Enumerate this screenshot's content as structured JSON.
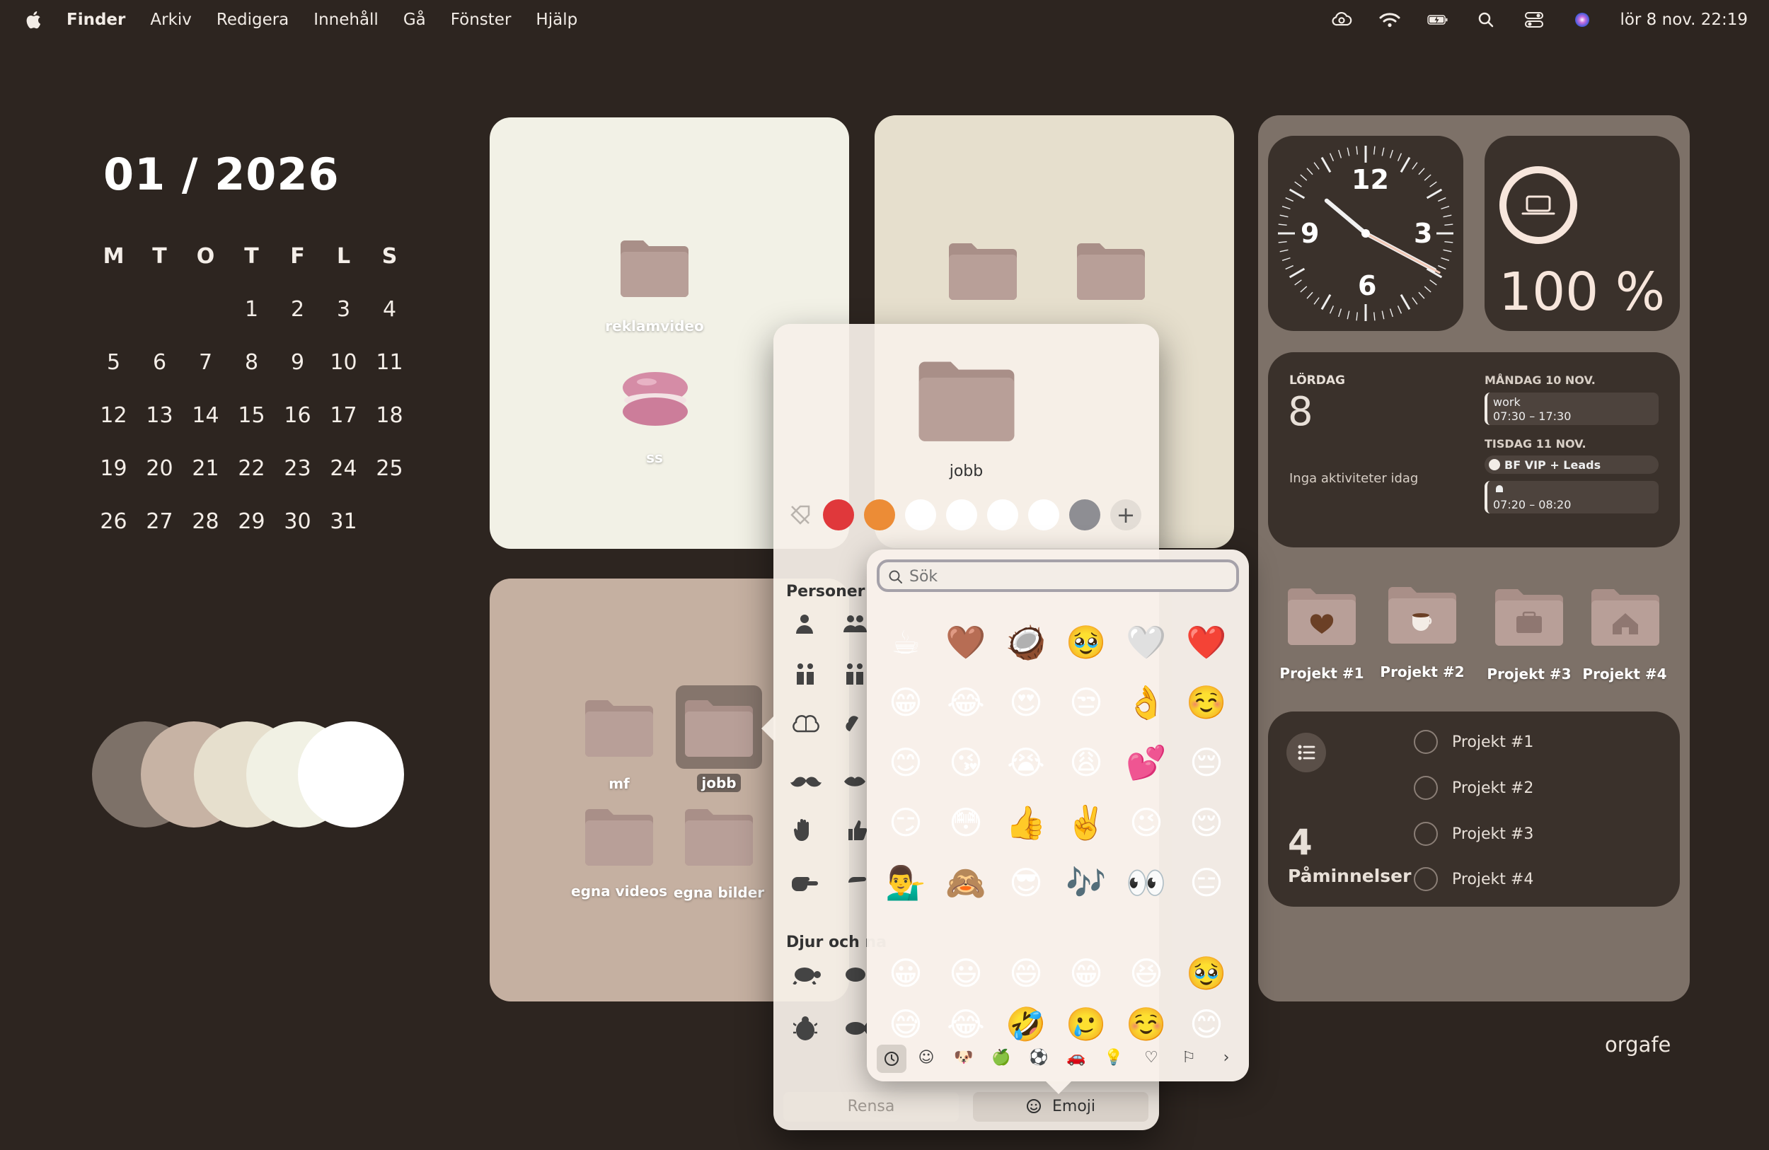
{
  "menubar": {
    "app": "Finder",
    "items": [
      "Arkiv",
      "Redigera",
      "Innehåll",
      "Gå",
      "Fönster",
      "Hjälp"
    ],
    "clock": "lör 8 nov. 22:19"
  },
  "calendar": {
    "title": "01 / 2026",
    "weekdays": [
      "M",
      "T",
      "O",
      "T",
      "F",
      "L",
      "S"
    ],
    "weeks": [
      [
        "",
        "",
        "",
        "1",
        "2",
        "3",
        "4"
      ],
      [
        "5",
        "6",
        "7",
        "8",
        "9",
        "10",
        "11"
      ],
      [
        "12",
        "13",
        "14",
        "15",
        "16",
        "17",
        "18"
      ],
      [
        "19",
        "20",
        "21",
        "22",
        "23",
        "24",
        "25"
      ],
      [
        "26",
        "27",
        "28",
        "29",
        "30",
        "31",
        ""
      ]
    ]
  },
  "palette": [
    "#7d7168",
    "#c7b3a4",
    "#e6dfcd",
    "#f1f1e4",
    "#ffffff"
  ],
  "desktop": {
    "panel1": {
      "folder_label": "reklamvideo",
      "image_label": "ss"
    },
    "panel3": {
      "folders": [
        "mf",
        "jobb",
        "egna videos",
        "egna bilder"
      ]
    }
  },
  "clock_widget": {
    "n12": "12",
    "n3": "3",
    "n6": "6",
    "n9": "9"
  },
  "battery_widget": {
    "value": "100 %",
    "level": 1.0
  },
  "calendar_widget": {
    "today_label": "LÖRDAG",
    "today_day": "8",
    "no_events": "Inga aktiviteter idag",
    "day1": "MÅNDAG 10 NOV.",
    "event1_title": "work",
    "event1_time": "07:30 – 17:30",
    "day2": "TISDAG 11 NOV.",
    "event2_title": "BF VIP + Leads",
    "event3_time": "07:20 – 08:20"
  },
  "project_folders": [
    "Projekt #1",
    "Projekt #2",
    "Projekt #3",
    "Projekt #4"
  ],
  "reminders": {
    "count": "4",
    "title": "Påminnelser",
    "items": [
      "Projekt #1",
      "Projekt #2",
      "Projekt #3",
      "Projekt #4"
    ]
  },
  "popup": {
    "folder_name": "jobb",
    "tag_colors": [
      "#e0383b",
      "#ec8c36",
      "#ffffff",
      "#ffffff",
      "#ffffff",
      "#ffffff",
      "#8e8e93"
    ],
    "section1": "Personer",
    "section2": "Djur och na",
    "clear_button": "Rensa",
    "emoji_button": "Emoji"
  },
  "emoji_picker": {
    "search_placeholder": "Sök",
    "rows": [
      [
        "☕",
        "🤎",
        "🥥",
        "🥹",
        "🤍",
        "❤️"
      ],
      [
        "😁",
        "😂",
        "😍",
        "😒",
        "👌",
        "☺️"
      ],
      [
        "😊",
        "😘",
        "😭",
        "😩",
        "💕",
        "😔"
      ],
      [
        "😏",
        "😳",
        "👍",
        "✌️",
        "😉",
        "😌"
      ],
      [
        "💁‍♂️",
        "🙈",
        "😎",
        "🎶",
        "👀",
        "😑"
      ],
      [
        "😀",
        "😃",
        "😄",
        "😁",
        "😆",
        "🥹"
      ],
      [
        "😅",
        "😂",
        "🤣",
        "🥲",
        "☺️",
        "😊"
      ]
    ]
  },
  "watermark": "orgafe"
}
